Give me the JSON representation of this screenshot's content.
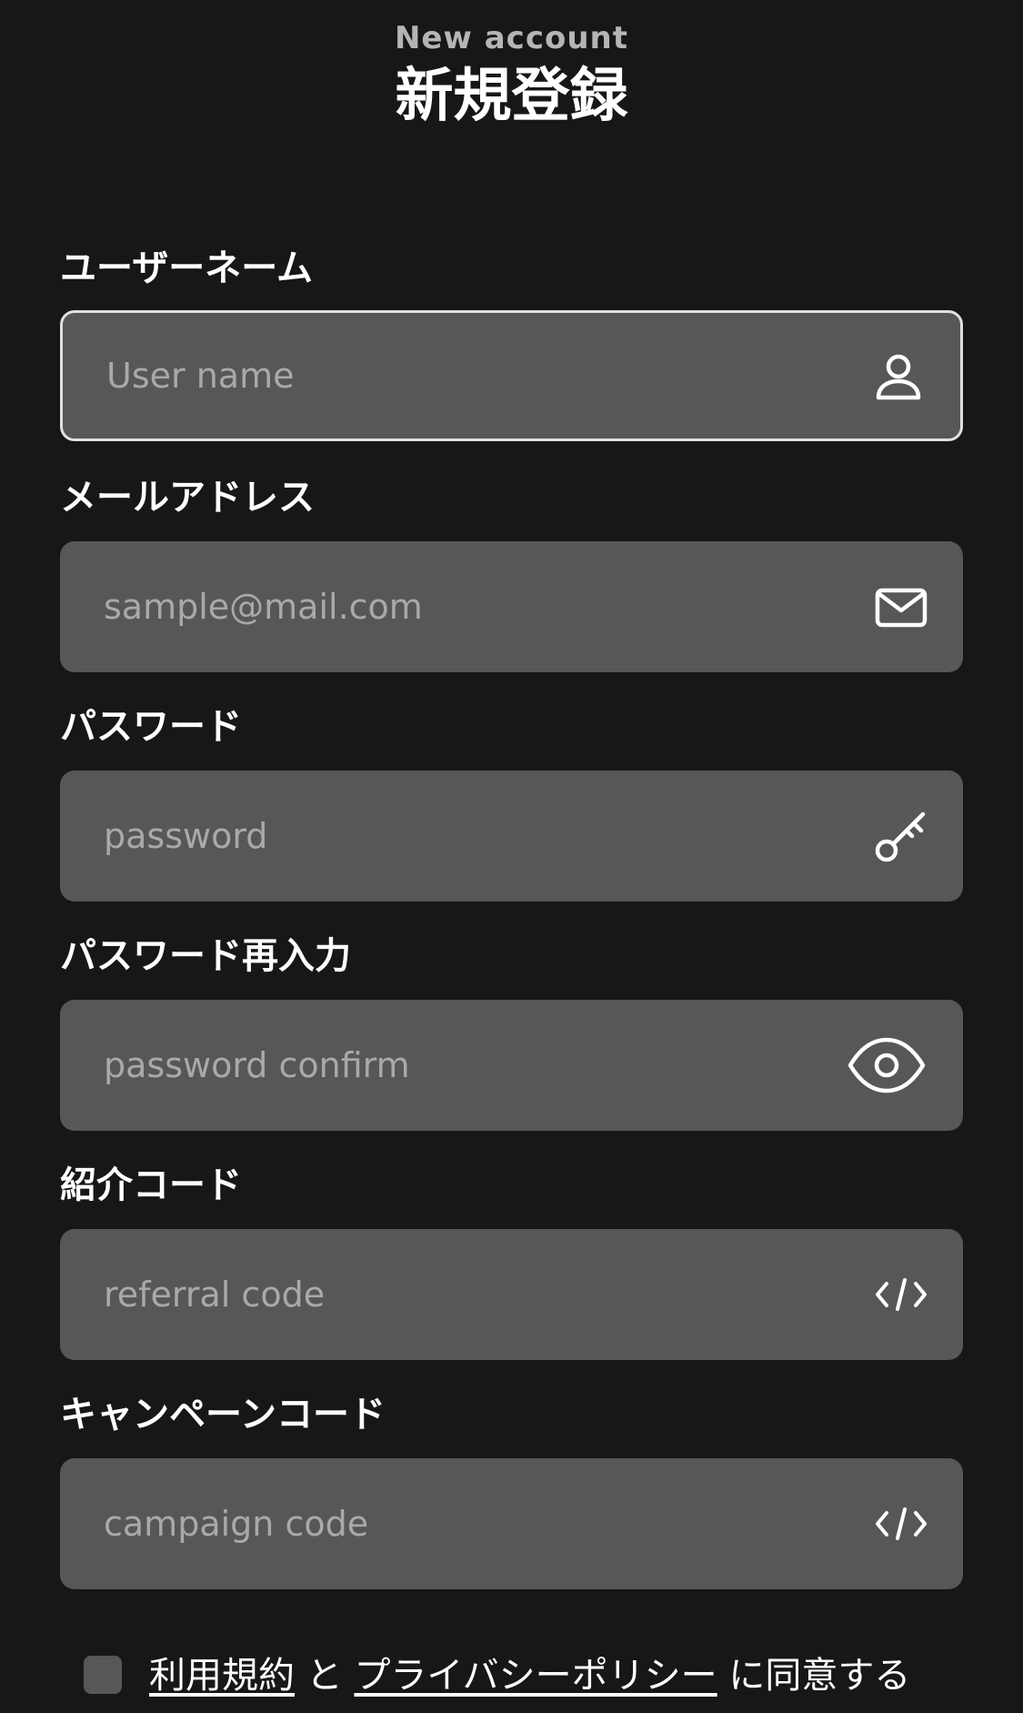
{
  "header": {
    "subtitle": "New account",
    "title": "新規登録"
  },
  "fields": [
    {
      "label": "ユーザーネーム",
      "placeholder": "User name",
      "icon": "user-icon",
      "focused": true
    },
    {
      "label": "メールアドレス",
      "placeholder": "sample@mail.com",
      "icon": "mail-icon",
      "focused": false
    },
    {
      "label": "パスワード",
      "placeholder": "password",
      "icon": "key-icon",
      "focused": false
    },
    {
      "label": "パスワード再入力",
      "placeholder": "password confirm",
      "icon": "eye-icon",
      "focused": false
    },
    {
      "label": "紹介コード",
      "placeholder": "referral code",
      "icon": "code-icon",
      "focused": false
    },
    {
      "label": "キャンペーンコード",
      "placeholder": "campaign code",
      "icon": "code-icon",
      "focused": false
    }
  ],
  "agreement": {
    "checked": false,
    "terms_link": "利用規約",
    "connector": "と",
    "privacy_link": "プライバシーポリシー",
    "suffix": "に同意する"
  },
  "colors": {
    "background": "#171717",
    "field_background": "#575757",
    "placeholder": "#a9a9a9",
    "focus_border": "#e0e0e0"
  }
}
